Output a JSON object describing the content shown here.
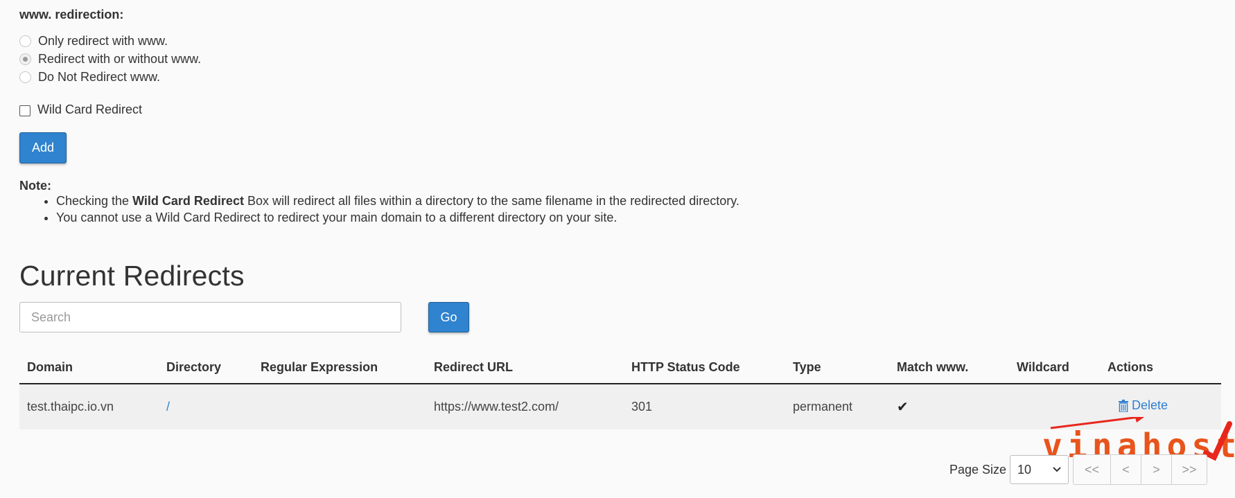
{
  "www_redirection": {
    "label": "www. redirection:",
    "options": [
      {
        "label": "Only redirect with www.",
        "checked": false
      },
      {
        "label": "Redirect with or without www.",
        "checked": true
      },
      {
        "label": "Do Not Redirect www.",
        "checked": false
      }
    ]
  },
  "wildcard_checkbox": {
    "label": "Wild Card Redirect",
    "checked": false
  },
  "add_button": {
    "label": "Add"
  },
  "note": {
    "title": "Note:",
    "item1_before": "Checking the ",
    "item1_bold": "Wild Card Redirect",
    "item1_after": " Box will redirect all files within a directory to the same filename in the redirected directory.",
    "item2": "You cannot use a Wild Card Redirect to redirect your main domain to a different directory on your site."
  },
  "current_redirects": {
    "title": "Current Redirects",
    "search_placeholder": "Search",
    "go_label": "Go"
  },
  "table": {
    "headers": [
      "Domain",
      "Directory",
      "Regular Expression",
      "Redirect URL",
      "HTTP Status Code",
      "Type",
      "Match www.",
      "Wildcard",
      "Actions"
    ],
    "rows": [
      {
        "domain": "test.thaipc.io.vn",
        "directory": "/",
        "regex": "",
        "redirect_url": "https://www.test2.com/",
        "status_code": "301",
        "type": "permanent",
        "match_www": "✔",
        "wildcard": "",
        "action": "Delete"
      }
    ]
  },
  "watermark": {
    "text": "vinahost",
    "color": "#e8541c"
  },
  "pager": {
    "page_size_label": "Page Size",
    "page_size_value": "10",
    "buttons": [
      "<<",
      "<",
      ">",
      ">>"
    ]
  },
  "colors": {
    "primary": "#2f83cf",
    "link": "#2f7fd0",
    "arrow": "#e8261c"
  }
}
